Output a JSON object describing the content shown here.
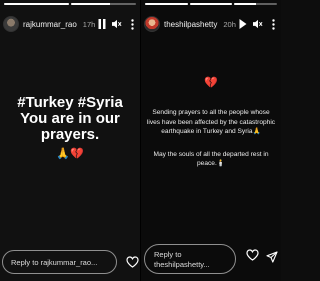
{
  "left_story": {
    "username": "rajkummar_rao",
    "time": "17h",
    "story_lines": [
      "#Turkey #Syria",
      "You are in our",
      "prayers."
    ],
    "story_emoji": "🙏💔",
    "reply_placeholder": "Reply to rajkummar_rao..."
  },
  "right_story": {
    "username": "theshilpashetty",
    "time": "20h",
    "heart_emoji": "💔",
    "paragraph1": "Sending prayers to all the people whose lives have been affected by the catastrophic earthquake in Turkey and Syria🙏",
    "paragraph2": "May the souls of all the departed rest in peace.🕯️",
    "reply_line1": "Reply to",
    "reply_line2": "theshilpashetty..."
  },
  "icons": {
    "pause": "pause-icon",
    "mute": "speaker-mute-icon",
    "play": "play-icon",
    "more": "more-icon",
    "like": "heart-icon",
    "send": "send-icon"
  },
  "progress": {
    "left": [
      1.0,
      0.6
    ],
    "right": [
      1.0,
      1.0,
      0.5
    ]
  }
}
